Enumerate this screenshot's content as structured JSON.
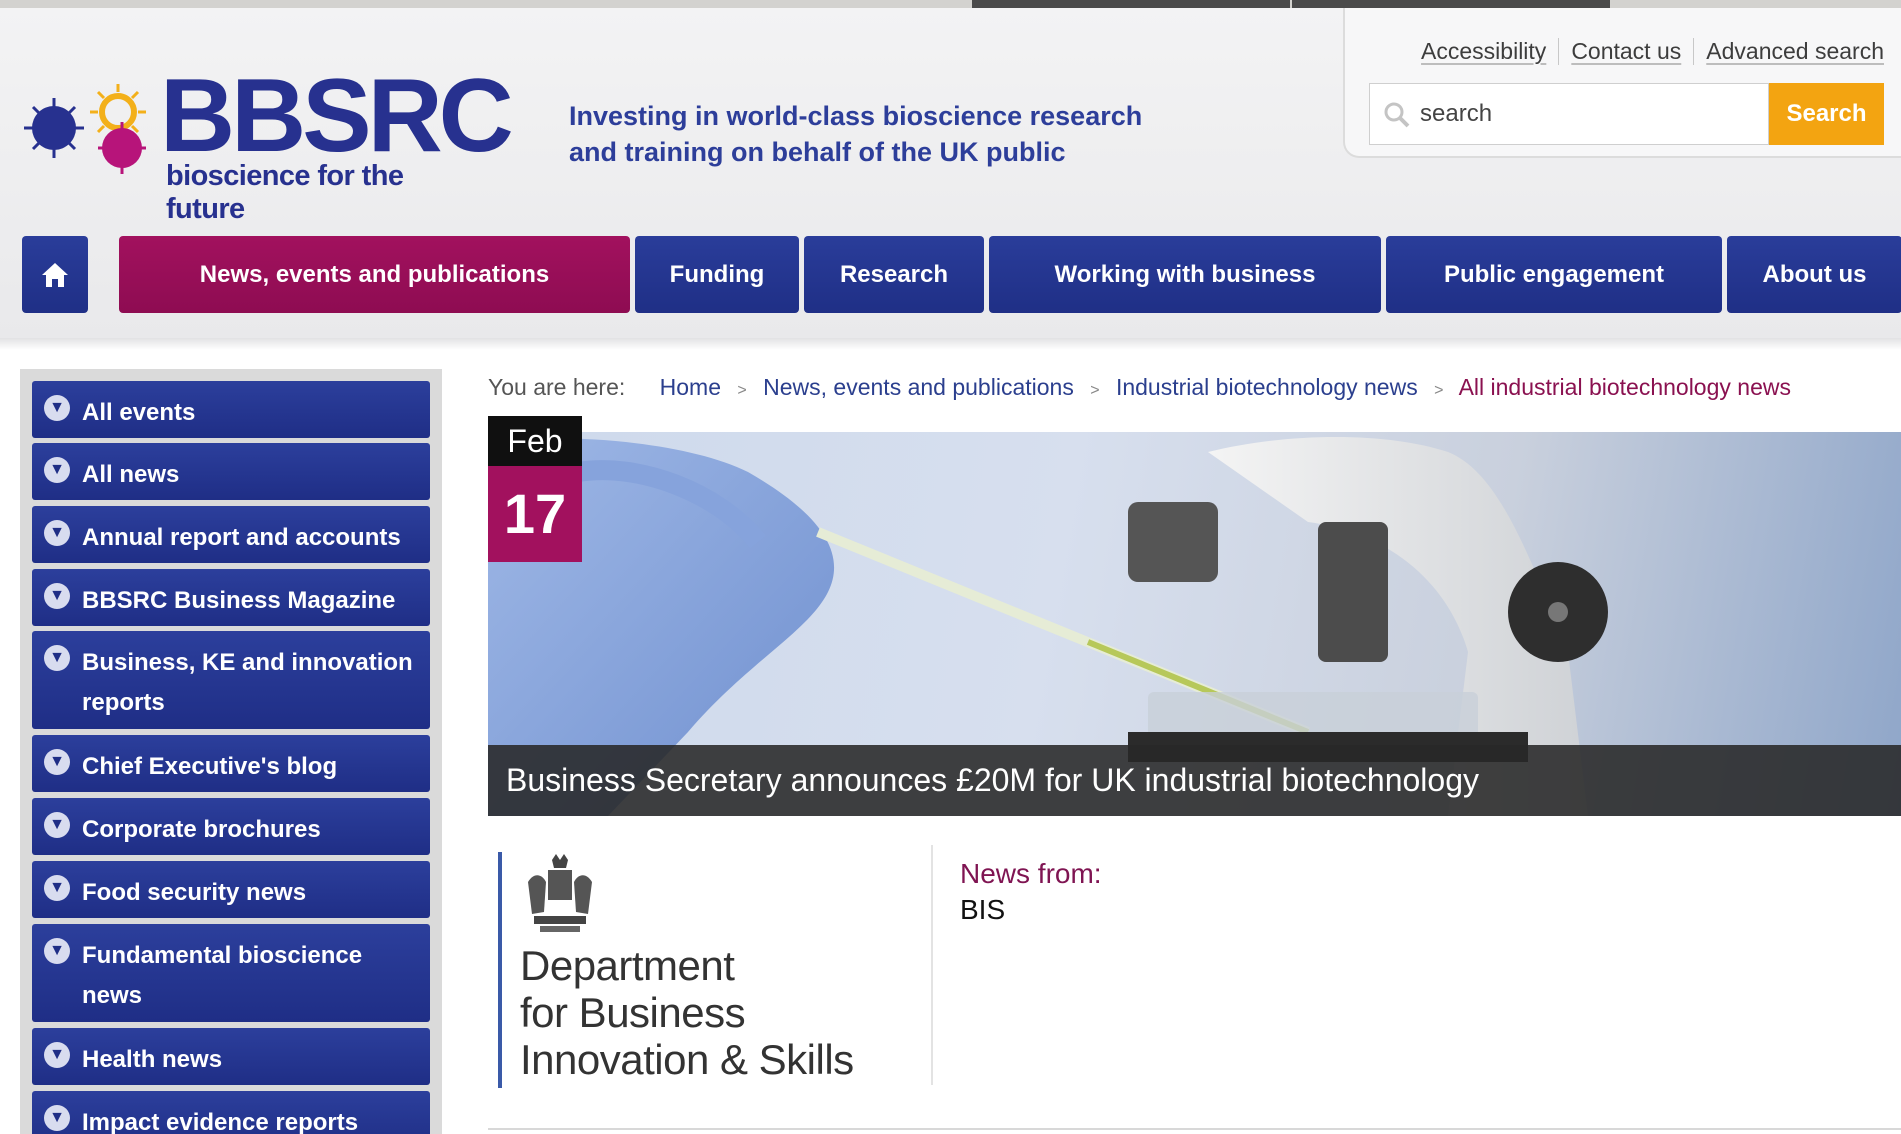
{
  "site": {
    "brand": "BBSRC",
    "tagline": "bioscience for the future",
    "strapline_line1": "Investing in world-class bioscience research",
    "strapline_line2": "and training on behalf of the UK public"
  },
  "utility_links": [
    "Accessibility",
    "Contact us",
    "Advanced search"
  ],
  "search": {
    "placeholder": "search",
    "value": "search",
    "button": "Search"
  },
  "nav": {
    "home_icon": "home-icon",
    "items": [
      "News, events and publications",
      "Funding",
      "Research",
      "Working with business",
      "Public engagement",
      "About us"
    ],
    "active_index": 0
  },
  "sidebar": {
    "items": [
      "All events",
      "All news",
      "Annual report and accounts",
      "BBSRC Business Magazine",
      "Business, KE and innovation reports",
      "Chief Executive's blog",
      "Corporate brochures",
      "Food security news",
      "Fundamental bioscience news",
      "Health news",
      "Impact evidence reports"
    ]
  },
  "breadcrumb": {
    "prefix": "You are here:",
    "items": [
      "Home",
      "News, events and publications",
      "Industrial biotechnology news",
      "All industrial biotechnology news"
    ]
  },
  "article": {
    "month": "Feb",
    "day": "17",
    "headline": "Business Secretary announces £20M for UK industrial biotechnology"
  },
  "news_from": {
    "label": "News from:",
    "source": "BIS",
    "logo_line1": "Department",
    "logo_line2": "for Business",
    "logo_line3": "Innovation & Skills"
  },
  "colors": {
    "brand_blue": "#27318f",
    "accent_magenta": "#a2115e",
    "search_orange": "#f3a411"
  }
}
